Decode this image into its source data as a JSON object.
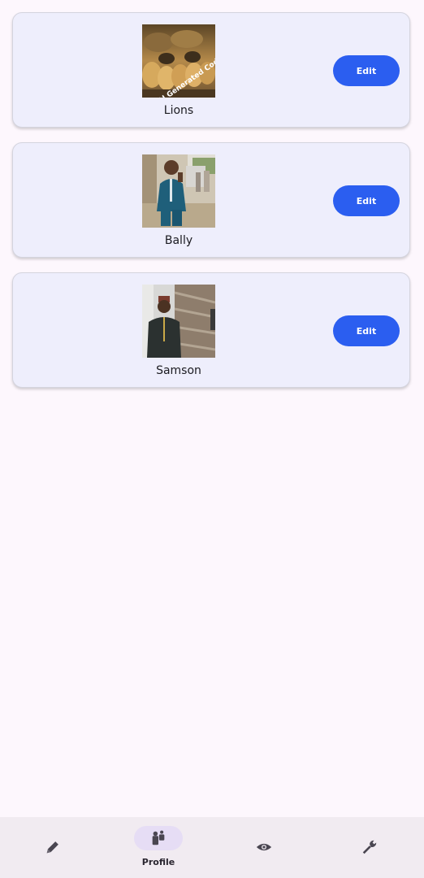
{
  "profiles": [
    {
      "name": "Lions",
      "edit_label": "Edit",
      "photo_overlay_text": "AI Generated Code"
    },
    {
      "name": "Bally",
      "edit_label": "Edit"
    },
    {
      "name": "Samson",
      "edit_label": "Edit"
    }
  ],
  "bottom_nav": {
    "items": [
      {
        "icon": "pencil-icon",
        "label": ""
      },
      {
        "icon": "profile-icon",
        "label": "Profile",
        "active": true
      },
      {
        "icon": "eye-icon",
        "label": ""
      },
      {
        "icon": "wrench-icon",
        "label": ""
      }
    ]
  },
  "colors": {
    "background": "#fdf7fd",
    "card": "#eeeefc",
    "button": "#2b5ef0",
    "nav_bar": "#f1ebf1",
    "nav_active_pill": "#e6ddf5"
  }
}
